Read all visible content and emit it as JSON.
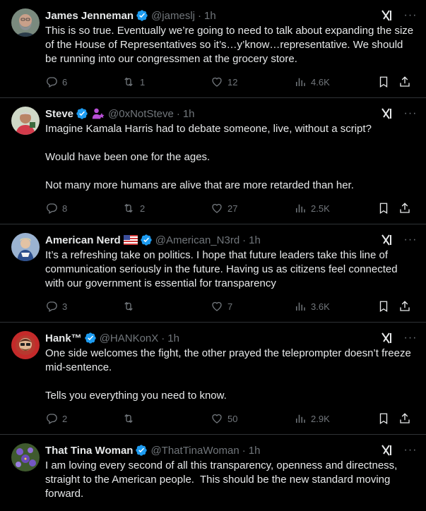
{
  "tweets": [
    {
      "name": "James Jenneman",
      "handle": "@jameslj",
      "time": "1h",
      "text": "This is so true. Eventually we’re going to need to talk about expanding the size of the House of Representatives so it’s…y’know…representative. We should be running into our congressmen at the grocery store.",
      "replies": "6",
      "reposts": "1",
      "likes": "12",
      "views": "4.6K"
    },
    {
      "name": "Steve",
      "handle": "@0xNotSteve",
      "time": "1h",
      "text": "Imagine Kamala Harris had to debate someone, live, without a script?\n\nWould have been one for the ages.\n\nNot many more humans are alive that are more retarded than her.",
      "replies": "8",
      "reposts": "2",
      "likes": "27",
      "views": "2.5K"
    },
    {
      "name": "American Nerd",
      "handle": "@American_N3rd",
      "time": "1h",
      "text": "It’s a refreshing take on politics. I hope that future leaders take this line of communication seriously in the future. Having us as citizens feel connected with our government is essential for transparency",
      "replies": "3",
      "reposts": "",
      "likes": "7",
      "views": "3.6K"
    },
    {
      "name": "Hank™",
      "handle": "@HANKonX",
      "time": "1h",
      "text": "One side welcomes the fight, the other prayed the teleprompter doesn’t freeze mid-sentence.\n\nTells you everything you need to know.",
      "replies": "2",
      "reposts": "",
      "likes": "50",
      "views": "2.9K"
    },
    {
      "name": "That Tina Woman",
      "handle": "@ThatTinaWoman",
      "time": "1h",
      "text": "I am loving every second of all this transparency, openness and directness, straight to the American people.  This should be the new standard moving forward.",
      "replies": "",
      "reposts": "",
      "likes": "",
      "views": ""
    }
  ],
  "colors": {
    "background": "#000000",
    "text": "#e7e9ea",
    "muted": "#71767b",
    "verified": "#1d9bf0",
    "divider": "#2f3336"
  },
  "separator": "·"
}
